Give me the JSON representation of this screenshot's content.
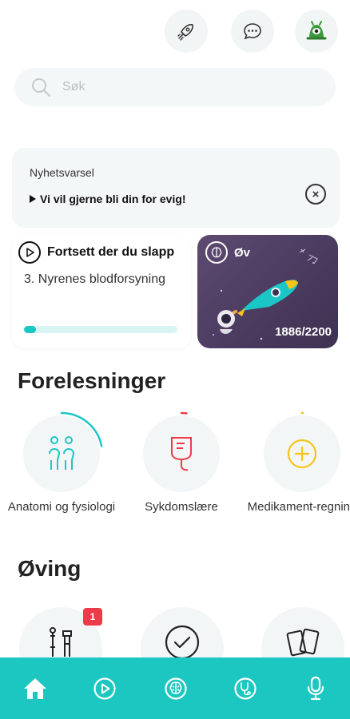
{
  "search": {
    "placeholder": "Søk"
  },
  "news": {
    "title": "Nyhetsvarsel",
    "message": "Vi vil gjerne bli din for evig!"
  },
  "continue_card": {
    "title": "Fortsett der du slapp",
    "subtitle": "3. Nyrenes blodforsyning",
    "progress": 0.08
  },
  "practice_card": {
    "title": "Øv",
    "count": "1886/2200"
  },
  "lectures": {
    "title": "Forelesninger",
    "items": [
      {
        "label": "Anatomi og fysiologi",
        "progress": 0.22,
        "color": "#1bc6c6",
        "icon": "people-icon"
      },
      {
        "label": "Sykdomslære",
        "progress": 0.02,
        "color": "#ef3b49",
        "icon": "iv-bag-icon"
      },
      {
        "label": "Medikament-regning",
        "progress": 0.0,
        "color": "#f5c518",
        "icon": "plus-circle-icon"
      }
    ]
  },
  "practice": {
    "title": "Øving",
    "badge": "1",
    "items": [
      {
        "icon": "tools-icon"
      },
      {
        "icon": "check-circle-icon"
      },
      {
        "icon": "cards-icon"
      }
    ]
  },
  "nav": [
    {
      "icon": "home-icon",
      "active": true
    },
    {
      "icon": "play-icon"
    },
    {
      "icon": "brain-icon"
    },
    {
      "icon": "stethoscope-icon"
    },
    {
      "icon": "microphone-icon"
    }
  ],
  "colors": {
    "accent": "#1cc6c1",
    "danger": "#ef3b49",
    "warning": "#f5c518",
    "practice_bg": "#4a3a5e"
  }
}
